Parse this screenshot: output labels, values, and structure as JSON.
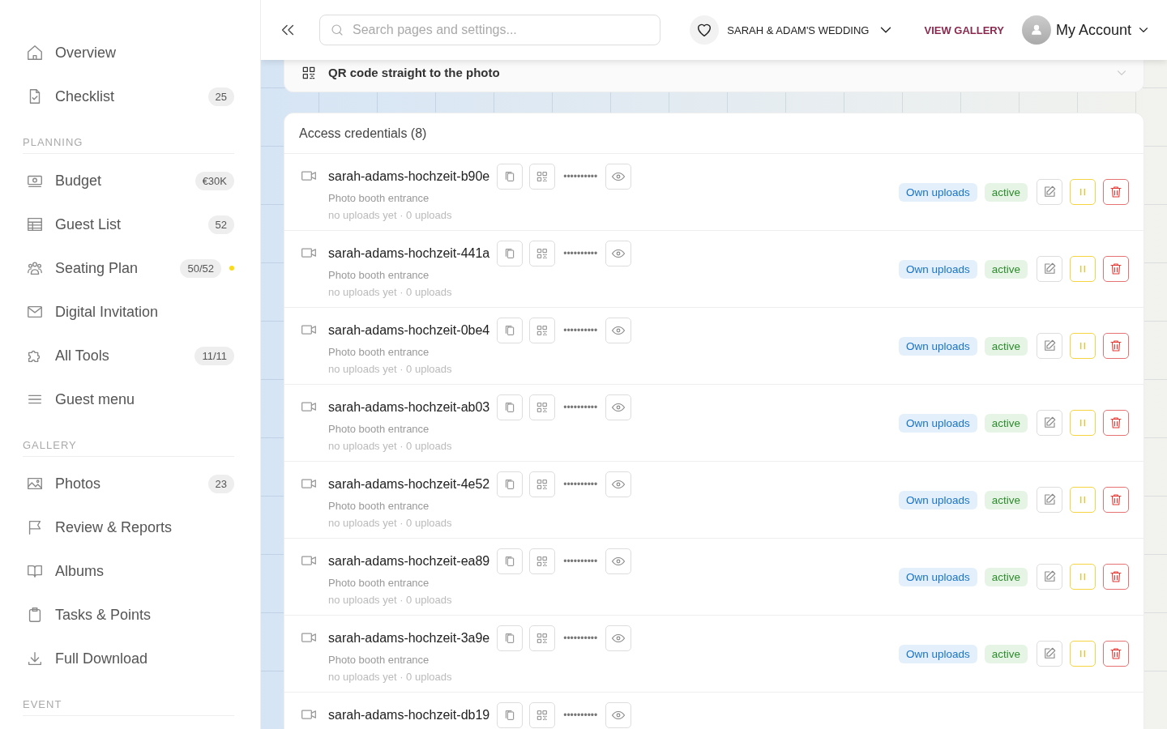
{
  "sidebar": {
    "sections": [
      {
        "items": [
          {
            "label": "Overview"
          },
          {
            "label": "Checklist",
            "badge": "25"
          }
        ]
      },
      {
        "heading": "PLANNING",
        "items": [
          {
            "label": "Budget",
            "badge": "€30K"
          },
          {
            "label": "Guest List",
            "badge": "52"
          },
          {
            "label": "Seating Plan",
            "badge": "50/52",
            "color": "#fadb14"
          },
          {
            "label": "Digital Invitation"
          },
          {
            "label": "All Tools",
            "badge": "11/11"
          },
          {
            "label": "Guest menu"
          }
        ]
      },
      {
        "heading": "GALLERY",
        "items": [
          {
            "label": "Photos",
            "badge": "23"
          },
          {
            "label": "Review & Reports"
          },
          {
            "label": "Albums"
          },
          {
            "label": "Tasks & Points"
          },
          {
            "label": "Full Download"
          }
        ]
      },
      {
        "heading": "EVENT"
      }
    ]
  },
  "header": {
    "search": {
      "placeholder": "Search pages and settings..."
    },
    "event": "SARAH & ADAM'S WEDDING",
    "view_gallery": "VIEW GALLERY",
    "account": "My Account"
  },
  "qr_card": {
    "title": "QR code straight to the photo"
  },
  "credentials": {
    "title": "Access credentials (8)",
    "rows": [
      {
        "name": "sarah-adams-hochzeit-b90e",
        "secret": "••••••••••",
        "description": "Photo booth entrance",
        "stats": "no uploads yet · 0 uploads",
        "source": "Own uploads",
        "status": "active"
      },
      {
        "name": "sarah-adams-hochzeit-441a",
        "secret": "••••••••••",
        "description": "Photo booth entrance",
        "stats": "no uploads yet · 0 uploads",
        "source": "Own uploads",
        "status": "active"
      },
      {
        "name": "sarah-adams-hochzeit-0be4",
        "secret": "••••••••••",
        "description": "Photo booth entrance",
        "stats": "no uploads yet · 0 uploads",
        "source": "Own uploads",
        "status": "active"
      },
      {
        "name": "sarah-adams-hochzeit-ab03",
        "secret": "••••••••••",
        "description": "Photo booth entrance",
        "stats": "no uploads yet · 0 uploads",
        "source": "Own uploads",
        "status": "active"
      },
      {
        "name": "sarah-adams-hochzeit-4e52",
        "secret": "••••••••••",
        "description": "Photo booth entrance",
        "stats": "no uploads yet · 0 uploads",
        "source": "Own uploads",
        "status": "active"
      },
      {
        "name": "sarah-adams-hochzeit-ea89",
        "secret": "••••••••••",
        "description": "Photo booth entrance",
        "stats": "no uploads yet · 0 uploads",
        "source": "Own uploads",
        "status": "active"
      },
      {
        "name": "sarah-adams-hochzeit-3a9e",
        "secret": "••••••••••",
        "description": "Photo booth entrance",
        "stats": "no uploads yet · 0 uploads",
        "source": "Own uploads",
        "status": "active"
      },
      {
        "name": "sarah-adams-hochzeit-db19",
        "secret": "••••••••••"
      }
    ]
  }
}
